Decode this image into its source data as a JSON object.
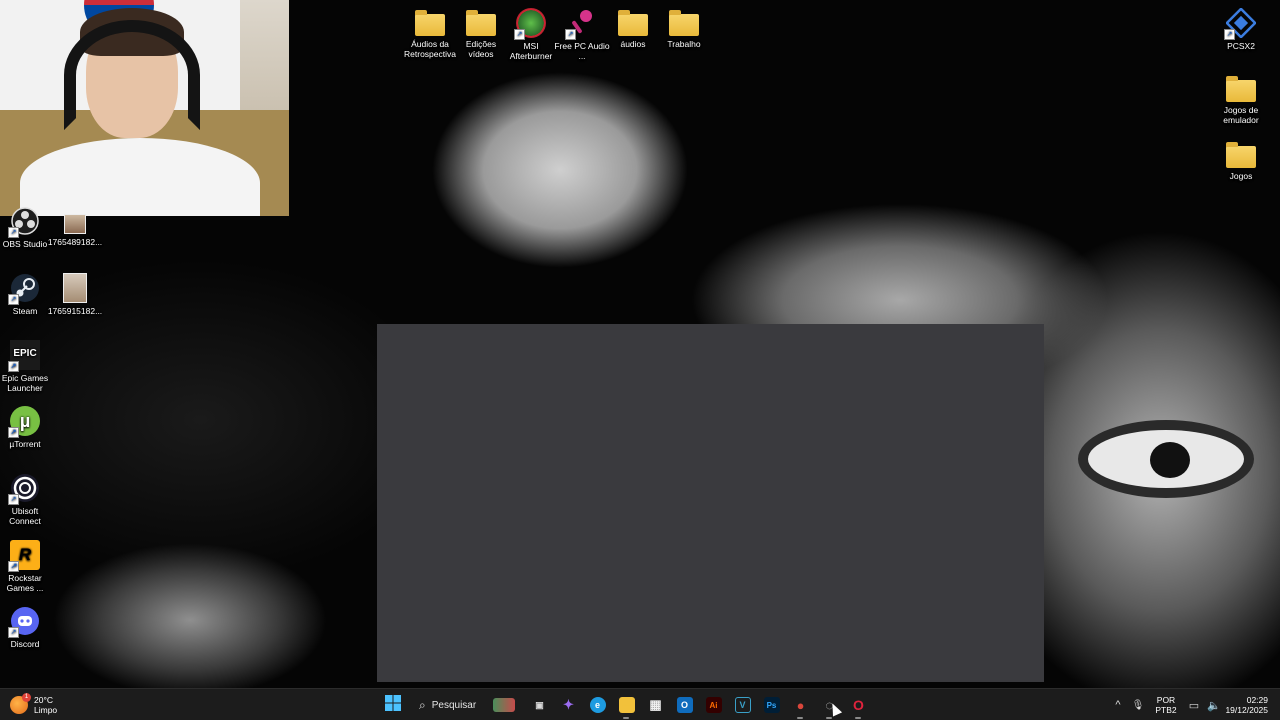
{
  "desktop_icons_top": [
    {
      "label": "Áudios da Retrospectiva",
      "icon": "folder-icon"
    },
    {
      "label": "Edições vídeos",
      "icon": "folder-icon"
    },
    {
      "label": "MSI Afterburner",
      "icon": "msi-afterburner-icon"
    },
    {
      "label": "Free PC Audio ...",
      "icon": "microphone-icon"
    },
    {
      "label": "áudios",
      "icon": "folder-icon"
    },
    {
      "label": "Trabalho",
      "icon": "folder-icon"
    }
  ],
  "desktop_icons_left": [
    {
      "label": "OBS Studio",
      "icon": "obs-icon"
    },
    {
      "label": "Steam",
      "icon": "steam-icon"
    },
    {
      "label": "Epic Games Launcher",
      "icon": "epic-games-icon",
      "glyph": "EPIC"
    },
    {
      "label": "µTorrent",
      "icon": "utorrent-icon",
      "glyph": "µ"
    },
    {
      "label": "Ubisoft Connect",
      "icon": "ubisoft-icon"
    },
    {
      "label": "Rockstar Games ...",
      "icon": "rockstar-icon",
      "glyph": "R"
    },
    {
      "label": "Discord",
      "icon": "discord-icon"
    }
  ],
  "desktop_icons_photos": [
    {
      "label": "1765489182...",
      "icon": "photo-icon"
    },
    {
      "label": "1765915182...",
      "icon": "photo-icon"
    }
  ],
  "desktop_icons_right": [
    {
      "label": "PCSX2",
      "icon": "pcsx2-icon"
    },
    {
      "label": "Jogos de emulador",
      "icon": "folder-icon"
    },
    {
      "label": "Jogos",
      "icon": "folder-icon"
    }
  ],
  "taskbar": {
    "weather": {
      "temp": "20°C",
      "condition": "Limpo",
      "badge": "1"
    },
    "search_placeholder": "Pesquisar",
    "apps": [
      {
        "name": "task-view",
        "glyph": "▣",
        "color": "#d9d9d9"
      },
      {
        "name": "copilot",
        "glyph": "✦",
        "color": "#9b6cf0"
      },
      {
        "name": "edge",
        "glyph": "e",
        "color": "#1e9be0"
      },
      {
        "name": "file-explorer",
        "glyph": "▬",
        "color": "#f2c13b"
      },
      {
        "name": "microsoft-store",
        "glyph": "▦",
        "color": "#f0f0f0"
      },
      {
        "name": "outlook",
        "glyph": "O",
        "color": "#0f6cbd"
      },
      {
        "name": "illustrator",
        "glyph": "Ai",
        "color": "#ff6a00"
      },
      {
        "name": "vegas",
        "glyph": "V",
        "color": "#3aa0c8"
      },
      {
        "name": "photoshop",
        "glyph": "Ps",
        "color": "#31a8ff"
      },
      {
        "name": "app-red",
        "glyph": "●",
        "color": "#d9463b"
      },
      {
        "name": "app-gauge",
        "glyph": "◌",
        "color": "#cfcfcf"
      },
      {
        "name": "opera",
        "glyph": "O",
        "color": "#e0233d"
      }
    ],
    "tray": {
      "chevron": "^",
      "mic": "🎙",
      "lang_line1": "POR",
      "lang_line2": "PTB2",
      "time": "02:29",
      "date": "19/12/2025"
    }
  }
}
